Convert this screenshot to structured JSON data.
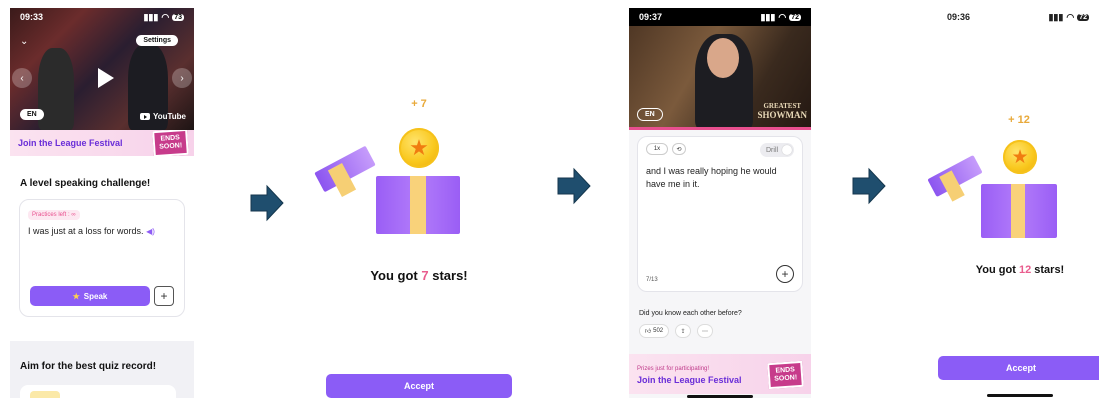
{
  "screen1": {
    "time": "09:33",
    "battery": "73",
    "settings_label": "Settings",
    "lang_label": "EN",
    "youtube_label": "YouTube",
    "banner": {
      "title": "Join the League Festival",
      "badge_line1": "ENDS",
      "badge_line2": "SOON!"
    },
    "challenge_title": "A level speaking challenge!",
    "practices_tag": "Practices left : ∞",
    "sentence": "I was just at a loss for words.",
    "speak_label": "Speak",
    "quiz_title": "Aim for the best quiz record!"
  },
  "screen2": {
    "plus_label": "+ 7",
    "got_prefix": "You got ",
    "got_count": "7",
    "got_suffix": " stars!",
    "accept_label": "Accept"
  },
  "screen3": {
    "time": "09:37",
    "battery": "72",
    "lang_label": "EN",
    "watermark_line1": "GREATEST",
    "watermark_line2": "SHOWMAN",
    "speed_label": "1x",
    "drill_label": "Drill",
    "lyric": "and I was really hoping he would have me in it.",
    "counter": "7/13",
    "question": "Did you know each other before?",
    "likes": "502",
    "banner": {
      "subtitle": "Prizes just for participating!",
      "title": "Join the League Festival",
      "badge_line1": "ENDS",
      "badge_line2": "SOON!"
    }
  },
  "screen4": {
    "time": "09:36",
    "battery": "72",
    "plus_label": "+ 12",
    "got_prefix": "You got ",
    "got_count": "12",
    "got_suffix": " stars!",
    "accept_label": "Accept"
  },
  "colors": {
    "accent": "#8b5cf6",
    "star_count": "#e95d8e",
    "arrow": "#1f4e6e",
    "gold": "#f9c81e"
  }
}
